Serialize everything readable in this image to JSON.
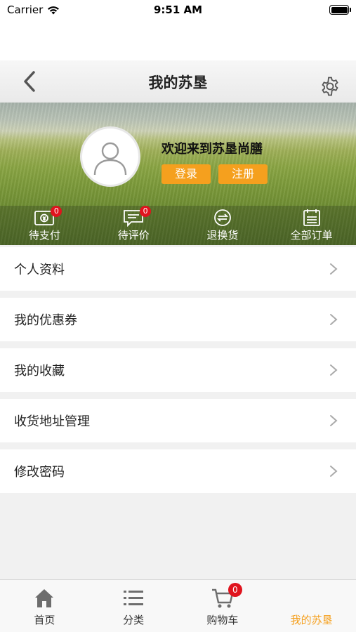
{
  "status_bar": {
    "carrier": "Carrier",
    "time": "9:51 AM"
  },
  "nav": {
    "title": "我的苏垦"
  },
  "banner": {
    "welcome": "欢迎来到苏垦尚膳",
    "login_label": "登录",
    "register_label": "注册",
    "orders": [
      {
        "label": "待支付",
        "badge": "0",
        "icon": "wallet-icon"
      },
      {
        "label": "待评价",
        "badge": "0",
        "icon": "comment-icon"
      },
      {
        "label": "退换货",
        "badge": "",
        "icon": "exchange-icon"
      },
      {
        "label": "全部订单",
        "badge": "",
        "icon": "orders-icon"
      }
    ]
  },
  "menu": {
    "items": [
      {
        "label": "个人资料"
      },
      {
        "label": "我的优惠券"
      },
      {
        "label": "我的收藏"
      },
      {
        "label": "收货地址管理"
      },
      {
        "label": "修改密码"
      }
    ]
  },
  "tab_bar": {
    "tabs": [
      {
        "label": "首页",
        "icon": "home-icon"
      },
      {
        "label": "分类",
        "icon": "list-icon"
      },
      {
        "label": "购物车",
        "icon": "cart-icon",
        "badge": "0"
      },
      {
        "label": "我的苏垦",
        "icon": "profile-icon",
        "active": true
      }
    ],
    "active_color": "#f5a01e"
  },
  "colors": {
    "accent": "#f5a01e",
    "badge": "#e0141e"
  }
}
